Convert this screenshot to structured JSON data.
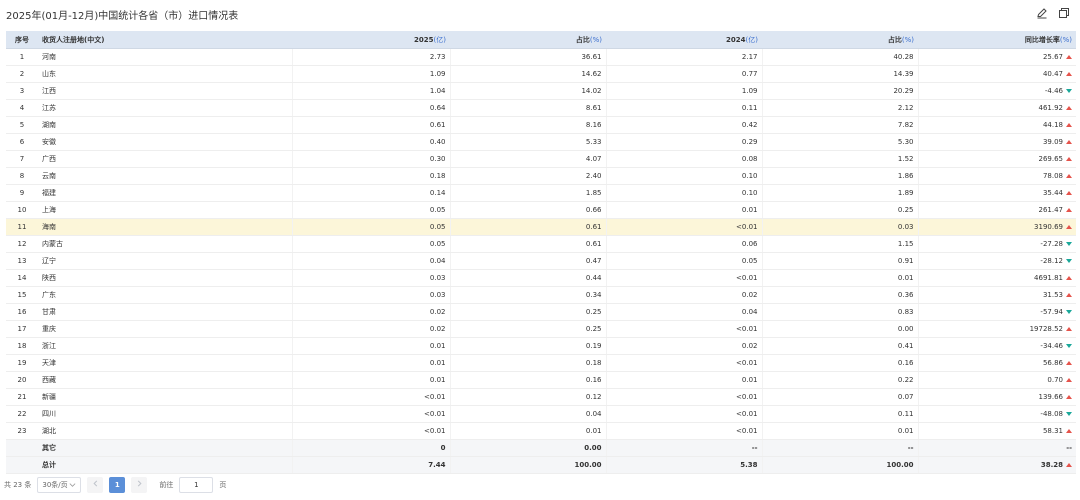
{
  "title": "2025年(01月-12月)中国统计各省（市）进口情况表",
  "toolbar": {
    "edit_icon": "edit-icon",
    "copy_icon": "copy-icon"
  },
  "colors": {
    "header_bg": "#dde6f2",
    "unit": "#3b6fcf",
    "up": "#e5534b",
    "down": "#1aa89a",
    "highlight": "#fcf6d9",
    "active_page": "#5b8fd8"
  },
  "table": {
    "headers": [
      {
        "label": "序号",
        "unit": ""
      },
      {
        "label": "收货人注册地(中文)",
        "unit": ""
      },
      {
        "label": "2025",
        "unit": "(亿)"
      },
      {
        "label": "占比",
        "unit": "(%)"
      },
      {
        "label": "2024",
        "unit": "(亿)"
      },
      {
        "label": "占比",
        "unit": "(%)"
      },
      {
        "label": "同比增长率",
        "unit": "(%)"
      }
    ],
    "rows": [
      {
        "idx": "1",
        "region": "河南",
        "v2025": "2.73",
        "s2025": "36.61",
        "v2024": "2.17",
        "s2024": "40.28",
        "growth": "25.67",
        "trend": "up"
      },
      {
        "idx": "2",
        "region": "山东",
        "v2025": "1.09",
        "s2025": "14.62",
        "v2024": "0.77",
        "s2024": "14.39",
        "growth": "40.47",
        "trend": "up"
      },
      {
        "idx": "3",
        "region": "江西",
        "v2025": "1.04",
        "s2025": "14.02",
        "v2024": "1.09",
        "s2024": "20.29",
        "growth": "-4.46",
        "trend": "down"
      },
      {
        "idx": "4",
        "region": "江苏",
        "v2025": "0.64",
        "s2025": "8.61",
        "v2024": "0.11",
        "s2024": "2.12",
        "growth": "461.92",
        "trend": "up"
      },
      {
        "idx": "5",
        "region": "湖南",
        "v2025": "0.61",
        "s2025": "8.16",
        "v2024": "0.42",
        "s2024": "7.82",
        "growth": "44.18",
        "trend": "up"
      },
      {
        "idx": "6",
        "region": "安徽",
        "v2025": "0.40",
        "s2025": "5.33",
        "v2024": "0.29",
        "s2024": "5.30",
        "growth": "39.09",
        "trend": "up"
      },
      {
        "idx": "7",
        "region": "广西",
        "v2025": "0.30",
        "s2025": "4.07",
        "v2024": "0.08",
        "s2024": "1.52",
        "growth": "269.65",
        "trend": "up"
      },
      {
        "idx": "8",
        "region": "云南",
        "v2025": "0.18",
        "s2025": "2.40",
        "v2024": "0.10",
        "s2024": "1.86",
        "growth": "78.08",
        "trend": "up"
      },
      {
        "idx": "9",
        "region": "福建",
        "v2025": "0.14",
        "s2025": "1.85",
        "v2024": "0.10",
        "s2024": "1.89",
        "growth": "35.44",
        "trend": "up"
      },
      {
        "idx": "10",
        "region": "上海",
        "v2025": "0.05",
        "s2025": "0.66",
        "v2024": "0.01",
        "s2024": "0.25",
        "growth": "261.47",
        "trend": "up"
      },
      {
        "idx": "11",
        "region": "海南",
        "v2025": "0.05",
        "s2025": "0.61",
        "v2024": "<0.01",
        "s2024": "0.03",
        "growth": "3190.69",
        "trend": "up",
        "highlight": true
      },
      {
        "idx": "12",
        "region": "内蒙古",
        "v2025": "0.05",
        "s2025": "0.61",
        "v2024": "0.06",
        "s2024": "1.15",
        "growth": "-27.28",
        "trend": "down"
      },
      {
        "idx": "13",
        "region": "辽宁",
        "v2025": "0.04",
        "s2025": "0.47",
        "v2024": "0.05",
        "s2024": "0.91",
        "growth": "-28.12",
        "trend": "down"
      },
      {
        "idx": "14",
        "region": "陕西",
        "v2025": "0.03",
        "s2025": "0.44",
        "v2024": "<0.01",
        "s2024": "0.01",
        "growth": "4691.81",
        "trend": "up"
      },
      {
        "idx": "15",
        "region": "广东",
        "v2025": "0.03",
        "s2025": "0.34",
        "v2024": "0.02",
        "s2024": "0.36",
        "growth": "31.53",
        "trend": "up"
      },
      {
        "idx": "16",
        "region": "甘肃",
        "v2025": "0.02",
        "s2025": "0.25",
        "v2024": "0.04",
        "s2024": "0.83",
        "growth": "-57.94",
        "trend": "down"
      },
      {
        "idx": "17",
        "region": "重庆",
        "v2025": "0.02",
        "s2025": "0.25",
        "v2024": "<0.01",
        "s2024": "0.00",
        "growth": "19728.52",
        "trend": "up"
      },
      {
        "idx": "18",
        "region": "浙江",
        "v2025": "0.01",
        "s2025": "0.19",
        "v2024": "0.02",
        "s2024": "0.41",
        "growth": "-34.46",
        "trend": "down"
      },
      {
        "idx": "19",
        "region": "天津",
        "v2025": "0.01",
        "s2025": "0.18",
        "v2024": "<0.01",
        "s2024": "0.16",
        "growth": "56.86",
        "trend": "up"
      },
      {
        "idx": "20",
        "region": "西藏",
        "v2025": "0.01",
        "s2025": "0.16",
        "v2024": "0.01",
        "s2024": "0.22",
        "growth": "0.70",
        "trend": "up"
      },
      {
        "idx": "21",
        "region": "新疆",
        "v2025": "<0.01",
        "s2025": "0.12",
        "v2024": "<0.01",
        "s2024": "0.07",
        "growth": "139.66",
        "trend": "up"
      },
      {
        "idx": "22",
        "region": "四川",
        "v2025": "<0.01",
        "s2025": "0.04",
        "v2024": "<0.01",
        "s2024": "0.11",
        "growth": "-48.08",
        "trend": "down"
      },
      {
        "idx": "23",
        "region": "湖北",
        "v2025": "<0.01",
        "s2025": "0.01",
        "v2024": "<0.01",
        "s2024": "0.01",
        "growth": "58.31",
        "trend": "up"
      }
    ],
    "other": {
      "idx": "",
      "region": "其它",
      "v2025": "0",
      "s2025": "0.00",
      "v2024": "--",
      "s2024": "--",
      "growth": "--"
    },
    "total": {
      "idx": "",
      "region": "总计",
      "v2025": "7.44",
      "s2025": "100.00",
      "v2024": "5.38",
      "s2024": "100.00",
      "growth": "38.28",
      "trend": "up"
    }
  },
  "pagination": {
    "total_text": "共 23 条",
    "page_size": "30条/页",
    "prev_icon": "chevron-left-icon",
    "next_icon": "chevron-right-icon",
    "current_page": "1",
    "goto_label": "前往",
    "goto_value": "1",
    "page_suffix": "页"
  }
}
